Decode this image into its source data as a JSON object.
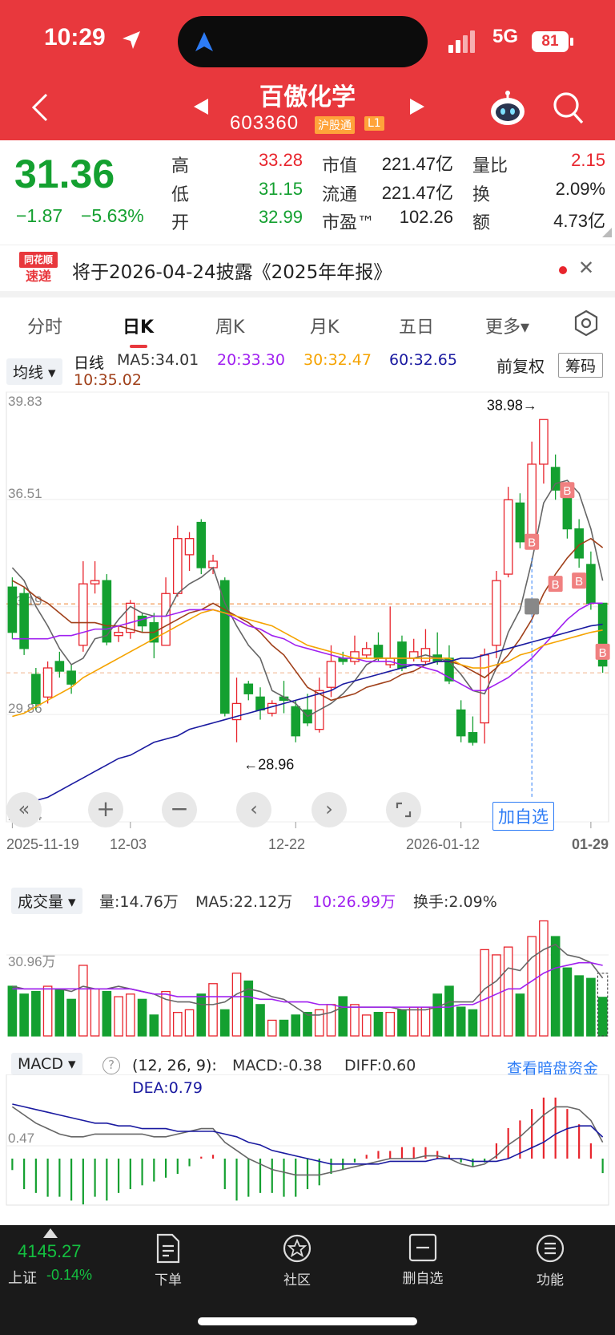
{
  "status_bar": {
    "time": "10:29",
    "network": "5G",
    "battery": "81"
  },
  "header": {
    "stock_name": "百傲化学",
    "stock_code": "603360",
    "badge_exchange": "沪股通",
    "badge_level": "L1"
  },
  "quote": {
    "price": "31.36",
    "change": "−1.87",
    "change_pct": "−5.63%",
    "high_label": "高",
    "high": "33.28",
    "low_label": "低",
    "low": "31.15",
    "open_label": "开",
    "open": "32.99",
    "mktcap_label": "市值",
    "mktcap": "221.47亿",
    "float_label": "流通",
    "float": "221.47亿",
    "pe_label": "市盈™",
    "pe": "102.26",
    "vol_ratio_label": "量比",
    "vol_ratio": "2.15",
    "turnover_label": "换",
    "turnover": "2.09%",
    "amount_label": "额",
    "amount": "4.73亿"
  },
  "notice": {
    "logo_line1": "同花顺",
    "logo_line2": "速递",
    "text": "将于2026-04-24披露《2025年年报》"
  },
  "tabs": [
    "分时",
    "日K",
    "周K",
    "月K",
    "五日",
    "更多▾"
  ],
  "active_tab": "日K",
  "chart_header": {
    "indicator_select": "均线",
    "line_label": "日线",
    "ma5": "MA5:34.01",
    "ma20": "20:33.30",
    "ma30": "30:32.47",
    "ma60": "60:32.65",
    "ma10": "10:35.02",
    "adjust": "前复权",
    "chips_button": "筹码"
  },
  "chart_controls": {
    "add_watch": "加自选"
  },
  "volume_header": {
    "select": "成交量",
    "vol": "量:14.76万",
    "ma5": "MA5:22.12万",
    "ma10": "10:26.99万",
    "turnover": "换手:2.09%"
  },
  "macd_header": {
    "select": "MACD",
    "help": "?",
    "params": "(12, 26, 9):",
    "macd": "MACD:-0.38",
    "diff": "DIFF:0.60",
    "dea": "DEA:0.79",
    "link": "查看暗盘资金"
  },
  "colors": {
    "up": "#e8252d",
    "down": "#14a030",
    "header_red": "#e8383d"
  },
  "chart_data": [
    {
      "type": "candlestick",
      "ylim": [
        26.54,
        39.83
      ],
      "y_ticks": [
        "39.83",
        "36.51",
        "33.19",
        "29.86",
        "26.54"
      ],
      "x_ticks": [
        "2025-11-19",
        "12-03",
        "12-22",
        "2026-01-12",
        "01-29"
      ],
      "annotations": {
        "max_label": "38.98→",
        "min_label": "←28.96"
      },
      "candles": [
        [
          33.8,
          32.4,
          34.1,
          32.2
        ],
        [
          33.6,
          31.9,
          33.8,
          31.7
        ],
        [
          31.1,
          30.2,
          31.3,
          30.0
        ],
        [
          30.4,
          31.3,
          31.5,
          30.2
        ],
        [
          31.5,
          31.2,
          31.8,
          31.0
        ],
        [
          31.2,
          30.8,
          31.4,
          30.5
        ],
        [
          32.0,
          33.9,
          34.6,
          31.8
        ],
        [
          33.9,
          34.0,
          34.6,
          33.6
        ],
        [
          34.0,
          32.1,
          34.2,
          32.0
        ],
        [
          32.3,
          32.4,
          32.6,
          32.1
        ],
        [
          32.4,
          33.3,
          33.4,
          32.2
        ],
        [
          32.9,
          32.6,
          33.0,
          32.4
        ],
        [
          32.7,
          32.1,
          33.0,
          31.6
        ],
        [
          32.0,
          33.6,
          34.1,
          32.0
        ],
        [
          33.6,
          35.3,
          35.7,
          33.5
        ],
        [
          34.8,
          35.3,
          35.5,
          34.3
        ],
        [
          35.8,
          34.4,
          35.9,
          34.2
        ],
        [
          34.4,
          34.6,
          34.8,
          34.2
        ],
        [
          34.0,
          29.9,
          34.1,
          29.8
        ],
        [
          29.7,
          30.2,
          31.0,
          29.0
        ],
        [
          30.8,
          30.5,
          30.9,
          30.3
        ],
        [
          30.4,
          30.0,
          30.7,
          29.7
        ],
        [
          29.9,
          30.2,
          30.3,
          29.8
        ],
        [
          30.4,
          30.3,
          30.9,
          29.9
        ],
        [
          30.1,
          29.2,
          30.3,
          29.0
        ],
        [
          30.0,
          29.6,
          30.5,
          29.5
        ],
        [
          29.4,
          30.6,
          31.0,
          29.3
        ],
        [
          30.7,
          31.5,
          32.0,
          30.4
        ],
        [
          31.6,
          31.5,
          31.8,
          31.4
        ],
        [
          31.5,
          31.8,
          32.3,
          31.4
        ],
        [
          31.7,
          31.9,
          32.1,
          31.6
        ],
        [
          32.0,
          31.6,
          32.4,
          31.5
        ],
        [
          31.4,
          31.6,
          33.2,
          31.3
        ],
        [
          32.1,
          31.3,
          32.3,
          31.2
        ],
        [
          31.6,
          31.8,
          32.2,
          31.5
        ],
        [
          31.5,
          31.9,
          32.5,
          31.4
        ],
        [
          31.7,
          31.5,
          32.4,
          31.4
        ],
        [
          31.6,
          30.9,
          32.0,
          30.8
        ],
        [
          30.0,
          29.2,
          30.3,
          29.0
        ],
        [
          29.3,
          29.0,
          29.8,
          28.9
        ],
        [
          29.6,
          31.7,
          31.9,
          28.96
        ],
        [
          32.0,
          34.0,
          34.3,
          31.6
        ],
        [
          34.2,
          36.5,
          36.9,
          34.1
        ],
        [
          36.4,
          35.2,
          36.7,
          35.0
        ],
        [
          35.1,
          37.6,
          38.3,
          35.0
        ],
        [
          37.6,
          38.98,
          38.98,
          37.0
        ],
        [
          37.5,
          36.8,
          37.9,
          36.5
        ],
        [
          36.7,
          35.6,
          36.8,
          35.3
        ],
        [
          35.6,
          34.7,
          35.9,
          34.4
        ],
        [
          34.5,
          33.3,
          34.9,
          33.1
        ],
        [
          33.3,
          31.36,
          33.28,
          31.15
        ]
      ],
      "series": [
        {
          "name": "MA5",
          "values": [
            34.4,
            34.0,
            33.2,
            32.6,
            31.9,
            31.4,
            31.6,
            32.2,
            32.3,
            32.8,
            33.2,
            33.0,
            32.9,
            32.9,
            33.6,
            33.9,
            34.1,
            34.4,
            33.3,
            32.6,
            32.0,
            31.6,
            30.6,
            30.4,
            30.2,
            29.8,
            30.0,
            30.2,
            30.5,
            30.9,
            31.4,
            31.6,
            31.6,
            31.6,
            31.6,
            31.7,
            31.6,
            31.5,
            31.1,
            30.6,
            30.5,
            31.3,
            32.4,
            33.1,
            34.6,
            36.4,
            37.0,
            37.1,
            36.7,
            35.6,
            34.0
          ]
        },
        {
          "name": "MA10",
          "values": [
            34.0,
            33.8,
            33.5,
            33.3,
            33.0,
            32.7,
            32.7,
            32.7,
            32.6,
            32.6,
            32.5,
            32.4,
            32.4,
            32.6,
            32.8,
            33.0,
            33.1,
            33.3,
            33.1,
            32.9,
            32.7,
            32.4,
            32.0,
            31.7,
            31.2,
            30.7,
            30.5,
            30.3,
            30.4,
            30.5,
            30.7,
            30.8,
            30.9,
            31.1,
            31.2,
            31.4,
            31.5,
            31.5,
            31.4,
            31.2,
            31.0,
            31.3,
            31.7,
            32.2,
            32.8,
            33.6,
            34.2,
            34.7,
            35.1,
            35.3,
            35.02
          ]
        },
        {
          "name": "MA20",
          "values": [
            32.2,
            32.2,
            32.2,
            32.2,
            32.3,
            32.3,
            32.4,
            32.5,
            32.5,
            32.6,
            32.7,
            32.8,
            32.9,
            32.9,
            33.0,
            33.1,
            33.1,
            33.1,
            33.0,
            32.8,
            32.6,
            32.5,
            32.3,
            32.2,
            32.0,
            31.9,
            31.8,
            31.7,
            31.6,
            31.6,
            31.5,
            31.5,
            31.5,
            31.4,
            31.4,
            31.3,
            31.2,
            31.0,
            30.8,
            30.6,
            30.6,
            30.8,
            31.0,
            31.3,
            31.6,
            32.0,
            32.4,
            32.8,
            33.1,
            33.3,
            33.3
          ]
        },
        {
          "name": "MA30",
          "values": [
            29.8,
            29.9,
            30.1,
            30.3,
            30.5,
            30.7,
            31.0,
            31.2,
            31.4,
            31.6,
            31.8,
            32.0,
            32.2,
            32.4,
            32.6,
            32.8,
            33.0,
            33.1,
            33.0,
            32.9,
            32.8,
            32.7,
            32.6,
            32.4,
            32.2,
            32.0,
            31.9,
            31.8,
            31.7,
            31.6,
            31.6,
            31.6,
            31.6,
            31.6,
            31.6,
            31.6,
            31.6,
            31.6,
            31.4,
            31.3,
            31.3,
            31.4,
            31.5,
            31.7,
            31.8,
            32.0,
            32.1,
            32.2,
            32.3,
            32.4,
            32.47
          ]
        },
        {
          "name": "MA60",
          "values": [
            26.8,
            27.0,
            27.2,
            27.3,
            27.5,
            27.7,
            27.9,
            28.1,
            28.3,
            28.5,
            28.6,
            28.8,
            29.0,
            29.1,
            29.2,
            29.4,
            29.5,
            29.6,
            29.7,
            29.8,
            29.9,
            30.0,
            30.1,
            30.2,
            30.3,
            30.4,
            30.5,
            30.6,
            30.8,
            30.9,
            31.0,
            31.1,
            31.2,
            31.3,
            31.4,
            31.4,
            31.5,
            31.5,
            31.6,
            31.6,
            31.7,
            31.8,
            31.9,
            32.0,
            32.1,
            32.2,
            32.3,
            32.4,
            32.5,
            32.6,
            32.65
          ]
        }
      ]
    },
    {
      "type": "bar",
      "title": "成交量",
      "y_tick": "30.96万",
      "values": [
        19,
        16,
        17,
        19,
        18,
        14,
        27,
        18,
        17,
        15,
        16,
        14,
        8,
        17,
        9,
        10,
        16,
        20,
        10,
        24,
        21,
        12,
        6,
        6,
        8,
        9,
        10,
        12,
        15,
        12,
        8,
        9,
        9,
        10,
        11,
        11,
        16,
        19,
        11,
        10,
        33,
        31,
        34,
        16,
        38,
        44,
        38,
        26,
        23,
        22,
        14.76
      ],
      "series": [
        {
          "name": "MA5",
          "values": [
            19,
            18,
            18,
            18,
            18,
            17,
            19,
            18,
            18,
            19,
            18,
            17,
            16,
            14,
            13,
            13,
            12,
            12,
            13,
            16,
            18,
            17,
            15,
            14,
            11,
            8,
            8,
            9,
            11,
            11,
            11,
            11,
            11,
            10,
            10,
            10,
            11,
            13,
            13,
            13,
            18,
            21,
            26,
            25,
            30,
            33,
            35,
            31,
            30,
            28,
            22.12
          ]
        },
        {
          "name": "MA10",
          "values": [
            18,
            18,
            18,
            18,
            18,
            18,
            18,
            18,
            18,
            18,
            18,
            17,
            16,
            16,
            15,
            15,
            15,
            15,
            15,
            15,
            15,
            14,
            14,
            13,
            13,
            13,
            12,
            12,
            11,
            11,
            11,
            11,
            11,
            11,
            11,
            11,
            11,
            11,
            12,
            12,
            14,
            16,
            18,
            18,
            21,
            24,
            26,
            27,
            28,
            28,
            26.99
          ]
        }
      ]
    },
    {
      "type": "bar",
      "title": "MACD (12, 26, 9)",
      "y_tick": "0.47",
      "values": [
        -0.3,
        -0.8,
        -0.9,
        -1.0,
        -1.0,
        -1.1,
        -1.2,
        -1.0,
        -1.1,
        -0.9,
        -0.8,
        -0.7,
        -0.6,
        -0.5,
        -0.4,
        -0.2,
        0.05,
        0.1,
        -0.8,
        -1.1,
        -1.0,
        -0.9,
        -0.9,
        -1.0,
        -1.0,
        -0.8,
        -0.7,
        -0.4,
        -0.3,
        -0.1,
        0.1,
        0.2,
        0.2,
        0.3,
        0.3,
        0.3,
        0.2,
        0.1,
        -0.1,
        -0.2,
        -0.1,
        0.4,
        0.8,
        1.0,
        1.3,
        1.6,
        1.6,
        1.3,
        0.9,
        0.4,
        -0.38
      ],
      "series": [
        {
          "name": "DIFF",
          "values": [
            1.9,
            1.6,
            1.3,
            1.1,
            0.9,
            0.8,
            0.8,
            0.9,
            0.9,
            0.9,
            0.9,
            0.9,
            0.8,
            0.8,
            0.9,
            1.0,
            1.1,
            1.1,
            0.6,
            0.3,
            0.0,
            -0.2,
            -0.4,
            -0.5,
            -0.6,
            -0.6,
            -0.6,
            -0.5,
            -0.4,
            -0.3,
            -0.2,
            -0.1,
            0.0,
            0.0,
            0.0,
            0.1,
            0.1,
            0.0,
            -0.2,
            -0.3,
            -0.2,
            0.1,
            0.5,
            0.8,
            1.2,
            1.6,
            1.9,
            1.9,
            1.8,
            1.4,
            0.6
          ]
        },
        {
          "name": "DEA",
          "values": [
            2.0,
            1.9,
            1.8,
            1.7,
            1.6,
            1.5,
            1.4,
            1.3,
            1.3,
            1.2,
            1.2,
            1.1,
            1.1,
            1.1,
            1.0,
            1.0,
            1.0,
            1.0,
            0.9,
            0.8,
            0.6,
            0.5,
            0.3,
            0.2,
            0.1,
            0.0,
            -0.1,
            -0.2,
            -0.2,
            -0.2,
            -0.2,
            -0.2,
            -0.1,
            -0.1,
            -0.1,
            -0.1,
            0.0,
            0.0,
            0.0,
            -0.1,
            -0.1,
            -0.1,
            0.0,
            0.2,
            0.4,
            0.6,
            0.9,
            1.1,
            1.2,
            1.2,
            0.79
          ]
        }
      ]
    }
  ],
  "index_bar": {
    "value": "4145.27",
    "name": "上证",
    "change_pct": "-0.14%"
  },
  "bottom_nav": [
    "下单",
    "社区",
    "删自选",
    "功能"
  ]
}
